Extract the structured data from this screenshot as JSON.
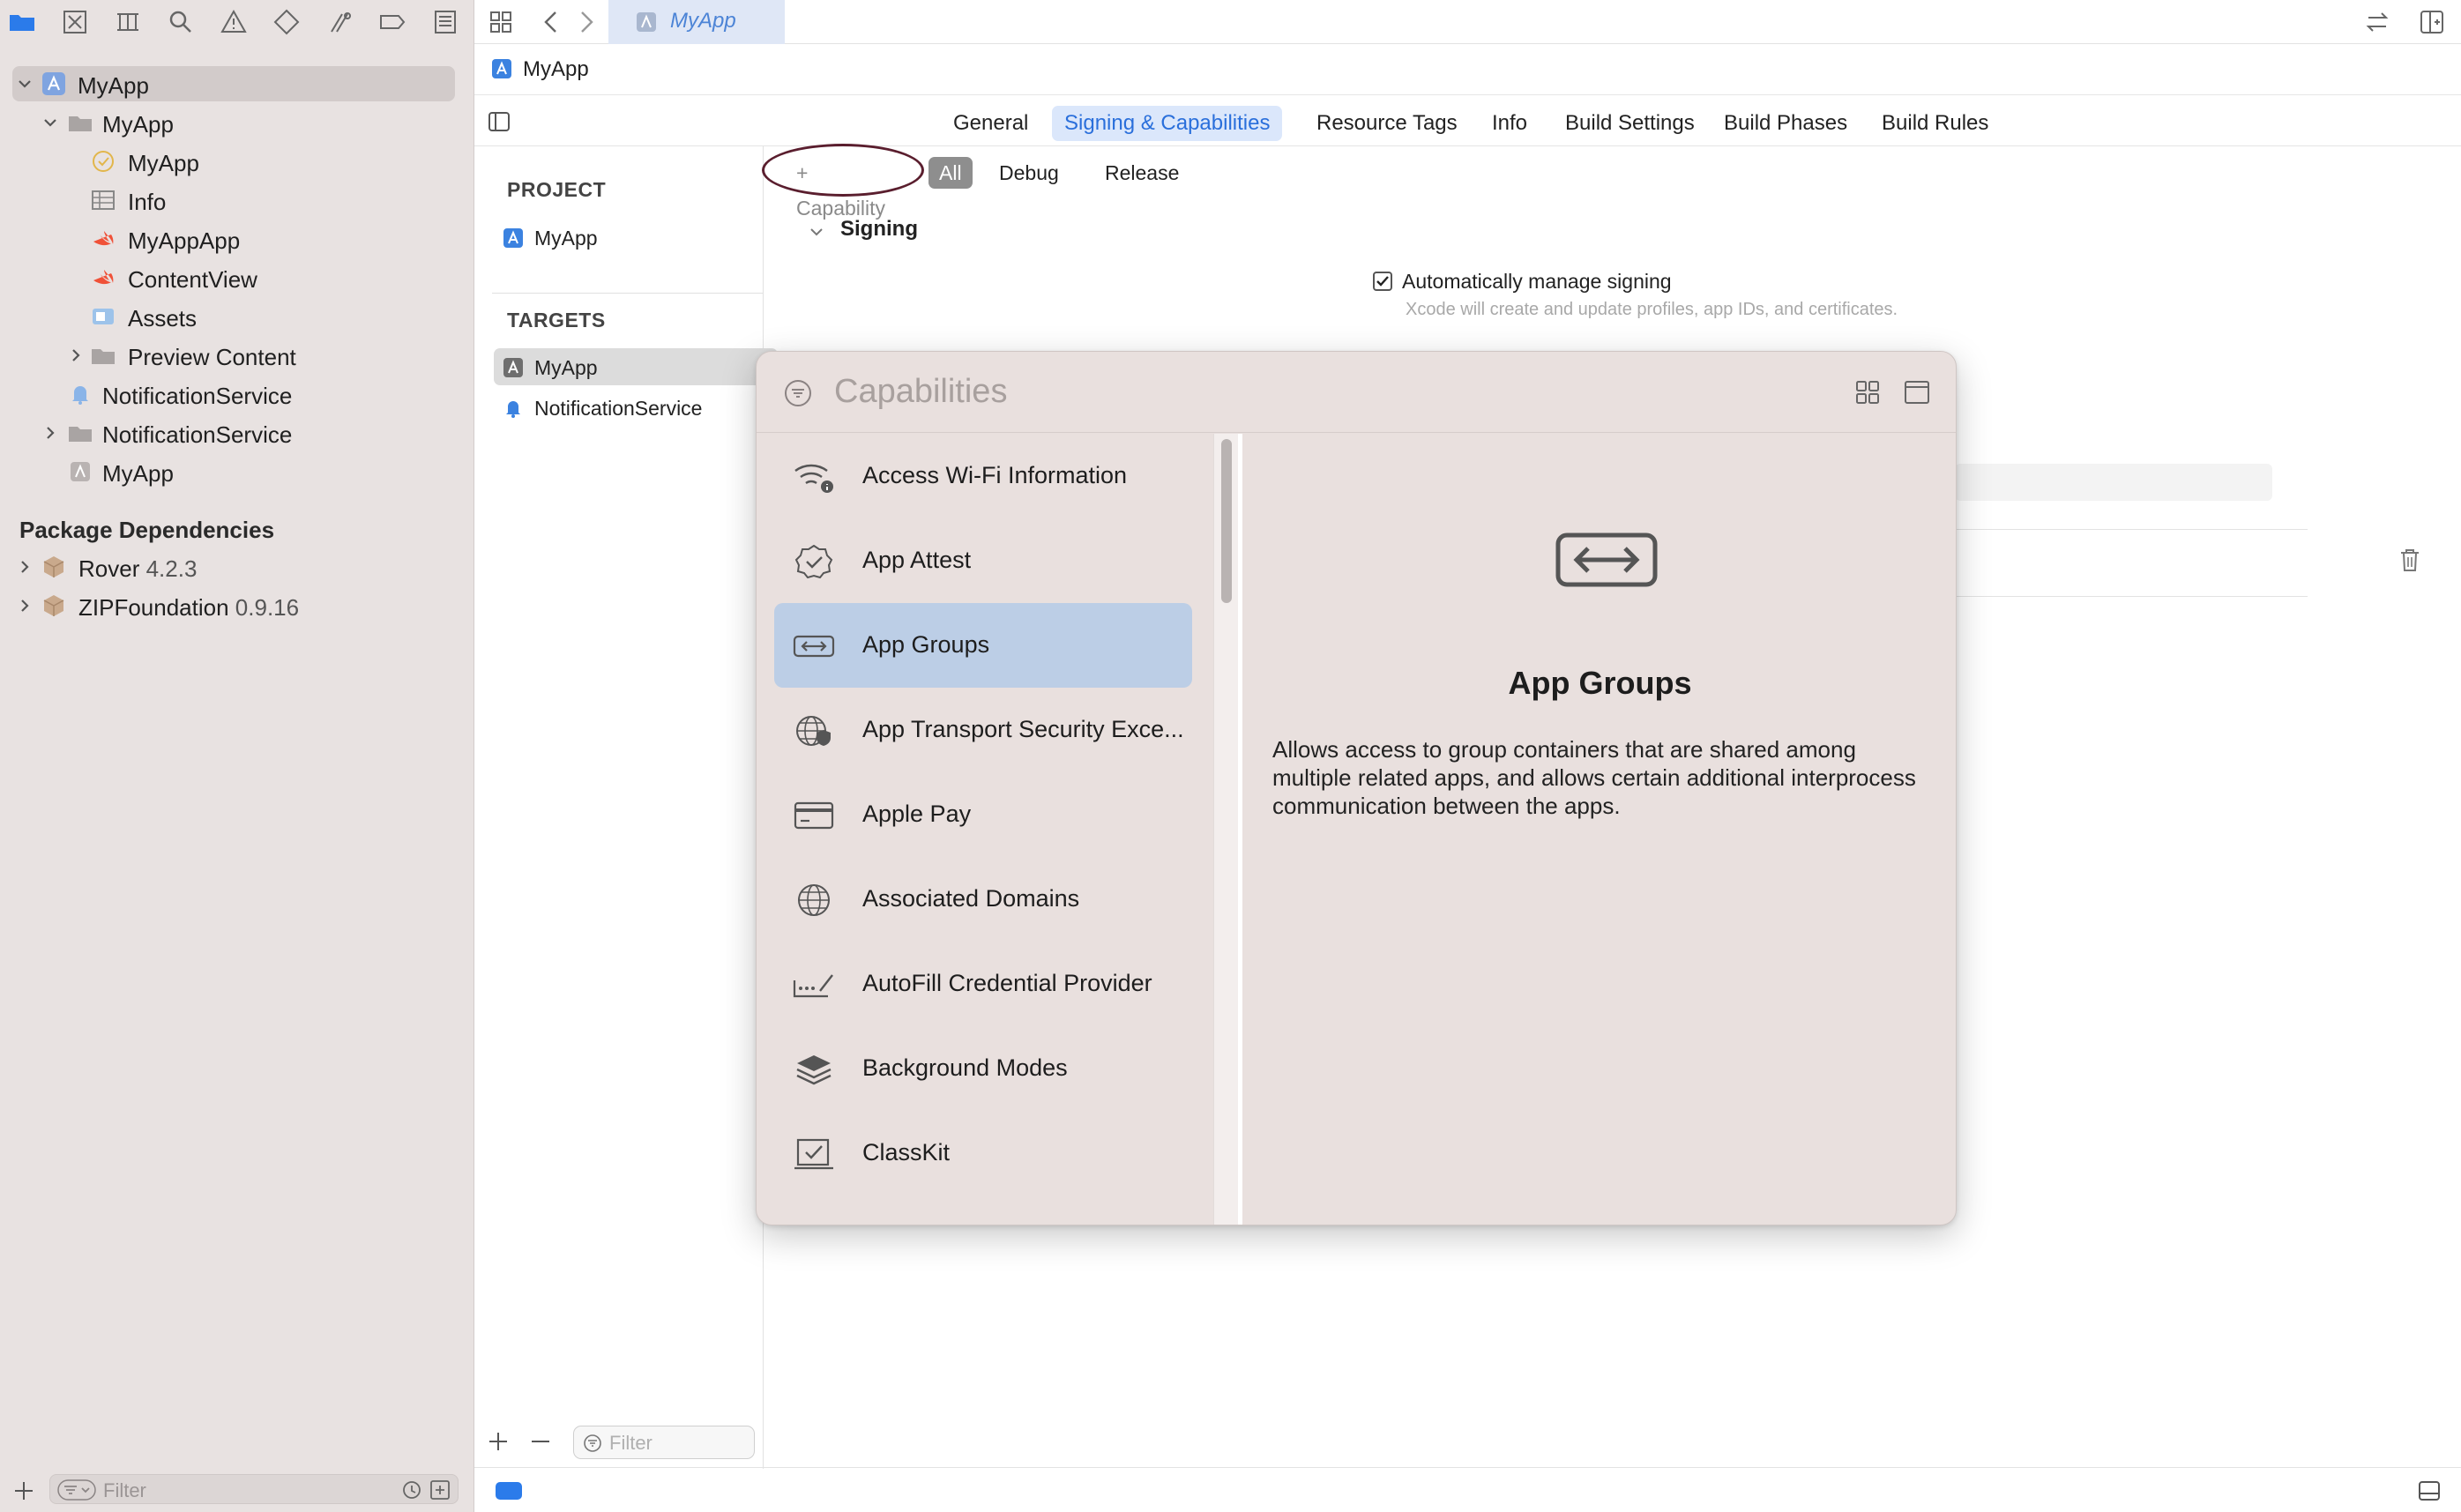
{
  "navigator": {
    "tree": [
      {
        "label": "MyApp",
        "icon": "xcode-project-icon",
        "level": 0,
        "expanded": true,
        "selected": true
      },
      {
        "label": "MyApp",
        "icon": "folder-icon",
        "level": 1,
        "expanded": true
      },
      {
        "label": "MyApp",
        "icon": "entitlements-icon",
        "level": 2
      },
      {
        "label": "Info",
        "icon": "plist-table-icon",
        "level": 2
      },
      {
        "label": "MyAppApp",
        "icon": "swift-file-icon",
        "level": 2
      },
      {
        "label": "ContentView",
        "icon": "swift-file-icon",
        "level": 2
      },
      {
        "label": "Assets",
        "icon": "asset-catalog-icon",
        "level": 2
      },
      {
        "label": "Preview Content",
        "icon": "folder-icon",
        "level": 2,
        "expanded": false
      },
      {
        "label": "NotificationService",
        "icon": "bell-extension-icon",
        "level": 1
      },
      {
        "label": "NotificationService",
        "icon": "folder-icon",
        "level": 1,
        "expanded": false
      },
      {
        "label": "MyApp",
        "icon": "app-product-icon",
        "level": 1
      }
    ],
    "package_dependencies_title": "Package Dependencies",
    "packages": [
      {
        "name": "Rover",
        "version": "4.2.3"
      },
      {
        "name": "ZIPFoundation",
        "version": "0.9.16"
      }
    ],
    "filter_placeholder": "Filter"
  },
  "topbar": {
    "file_tab": "MyApp"
  },
  "jumpbar": {
    "project": "MyApp"
  },
  "tabs": [
    {
      "label": "General",
      "active": false
    },
    {
      "label": "Signing & Capabilities",
      "active": true
    },
    {
      "label": "Resource Tags",
      "active": false
    },
    {
      "label": "Info",
      "active": false
    },
    {
      "label": "Build Settings",
      "active": false
    },
    {
      "label": "Build Phases",
      "active": false
    },
    {
      "label": "Build Rules",
      "active": false
    }
  ],
  "targets_column": {
    "project_header": "PROJECT",
    "project_item": "MyApp",
    "targets_header": "TARGETS",
    "targets": [
      {
        "label": "MyApp",
        "selected": true
      },
      {
        "label": "NotificationService",
        "selected": false
      }
    ],
    "filter_placeholder": "Filter"
  },
  "editor": {
    "add_capability": "+ Capability",
    "segments": [
      {
        "label": "All",
        "active": true
      },
      {
        "label": "Debug",
        "active": false
      },
      {
        "label": "Release",
        "active": false
      }
    ],
    "signing_header": "Signing",
    "auto_manage_label": "Automatically manage signing",
    "auto_manage_checked": true,
    "auto_manage_desc": "Xcode will create and update profiles, app IDs, and certificates."
  },
  "capabilities_popover": {
    "search_placeholder": "Capabilities",
    "items": [
      {
        "label": "Access Wi-Fi Information",
        "icon": "wifi-info-icon",
        "selected": false
      },
      {
        "label": "App Attest",
        "icon": "badge-check-icon",
        "selected": false
      },
      {
        "label": "App Groups",
        "icon": "app-groups-link-icon",
        "selected": true
      },
      {
        "label": "App Transport Security Exce...",
        "icon": "globe-shield-icon",
        "selected": false
      },
      {
        "label": "Apple Pay",
        "icon": "credit-card-icon",
        "selected": false
      },
      {
        "label": "Associated Domains",
        "icon": "globe-icon",
        "selected": false
      },
      {
        "label": "AutoFill Credential Provider",
        "icon": "password-field-icon",
        "selected": false
      },
      {
        "label": "Background Modes",
        "icon": "layers-icon",
        "selected": false
      },
      {
        "label": "ClassKit",
        "icon": "classkit-checkbox-icon",
        "selected": false
      }
    ],
    "detail": {
      "title": "App Groups",
      "description": "Allows access to group containers that are shared among multiple related apps, and allows certain additional interprocess communication between the apps."
    }
  },
  "colors": {
    "accent": "#2b7bea",
    "selection_blue": "#bccee6",
    "navigator_bg": "#e8e2e1",
    "popover_bg": "#e9e0de",
    "annotation_ring": "#5a1e2e"
  }
}
